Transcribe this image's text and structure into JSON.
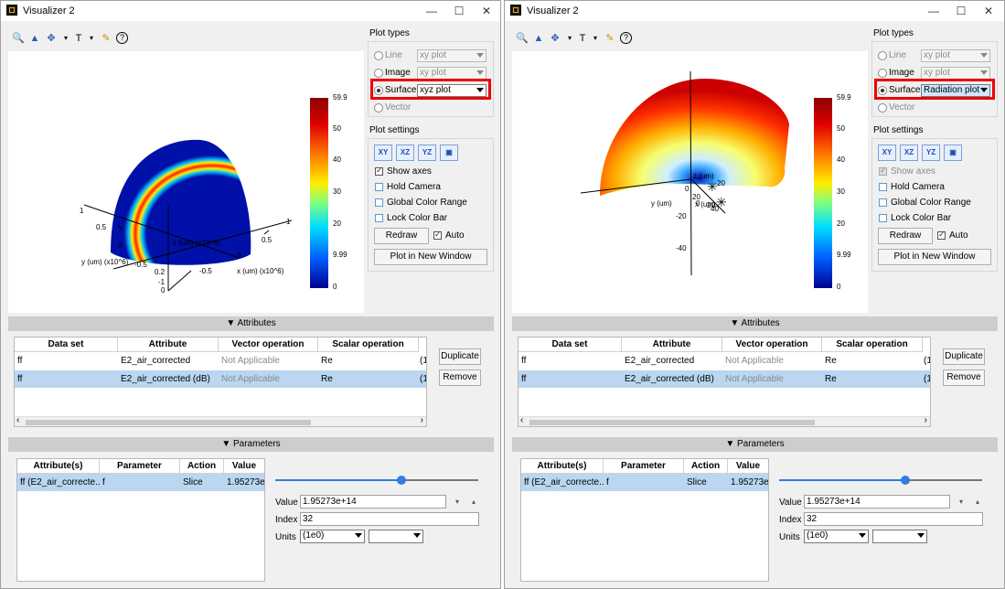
{
  "windows": [
    {
      "title": "Visualizer 2",
      "window_buttons": {
        "minimize": "—",
        "maximize": "☐",
        "close": "✕"
      },
      "colorbar_labels": [
        "59.9",
        "50",
        "40",
        "30",
        "20",
        "9.99",
        "0"
      ],
      "axis_labels": {
        "x": "x (um) (x10^6)",
        "y": "y (um) (x10^6)",
        "z": "z (um) (x10^6)",
        "ticks": [
          "1",
          "0.5",
          "0",
          "-0.5",
          "-1",
          "0.5",
          "0",
          "-0.5",
          "1",
          "0.2",
          "0"
        ]
      },
      "plot_types": {
        "heading": "Plot types",
        "line": {
          "label": "Line",
          "combo": "xy plot",
          "enabled": false
        },
        "image": {
          "label": "Image",
          "combo": "xy plot",
          "enabled": false
        },
        "surface": {
          "label": "Surface",
          "combo": "xyz plot",
          "selected": true
        },
        "vector": {
          "label": "Vector",
          "enabled": false
        }
      },
      "plot_settings": {
        "heading": "Plot settings",
        "buttons": [
          "XY",
          "XZ",
          "YZ"
        ],
        "show_axes": {
          "label": "Show axes",
          "checked": true,
          "enabled": true
        },
        "hold_camera": "Hold Camera",
        "global_color_range": "Global Color Range",
        "lock_color_bar": "Lock Color Bar",
        "redraw": "Redraw",
        "auto": {
          "label": "Auto",
          "checked": true
        },
        "plot_new_window": "Plot in New Window"
      },
      "attributes": {
        "heading": "Attributes",
        "columns": [
          "Data set",
          "Attribute",
          "Vector operation",
          "Scalar operation"
        ],
        "rows": [
          {
            "dataset": "ff",
            "attribute": "E2_air_corrected",
            "vector": "Not Applicable",
            "scalar": "Re",
            "extra": "(1",
            "selected": false
          },
          {
            "dataset": "ff",
            "attribute": "E2_air_corrected (dB)",
            "vector": "Not Applicable",
            "scalar": "Re",
            "extra": "(1",
            "selected": true
          }
        ],
        "duplicate": "Duplicate",
        "remove": "Remove"
      },
      "parameters": {
        "heading": "Parameters",
        "columns": [
          "Attribute(s)",
          "Parameter",
          "Action",
          "Value"
        ],
        "rows": [
          {
            "attribute": "ff (E2_air_correcte...",
            "parameter": "f",
            "action": "Slice",
            "value": "1.95273e+"
          }
        ],
        "slider_level": 0.62,
        "value_label": "Value",
        "value": "1.95273e+14",
        "index_label": "Index",
        "index": "32",
        "units_label": "Units",
        "units": "(1e0)",
        "units2": ""
      }
    },
    {
      "title": "Visualizer 2",
      "window_buttons": {
        "minimize": "—",
        "maximize": "☐",
        "close": "✕"
      },
      "colorbar_labels": [
        "59.9",
        "50",
        "40",
        "30",
        "20",
        "9.99",
        "0"
      ],
      "axis_labels": {
        "y": "y (um)",
        "z": "z (um)",
        "x": "x (um)",
        "ticks": [
          "20",
          "0",
          "-20",
          "-40",
          "20",
          "0",
          "20",
          "40"
        ]
      },
      "plot_types": {
        "heading": "Plot types",
        "line": {
          "label": "Line",
          "combo": "xy plot",
          "enabled": false
        },
        "image": {
          "label": "Image",
          "combo": "xy plot",
          "enabled": false
        },
        "surface": {
          "label": "Surface",
          "combo": "Radiation plot",
          "selected": true
        },
        "vector": {
          "label": "Vector",
          "enabled": false
        }
      },
      "plot_settings": {
        "heading": "Plot settings",
        "buttons": [
          "XY",
          "XZ",
          "YZ"
        ],
        "show_axes": {
          "label": "Show axes",
          "checked": true,
          "enabled": false
        },
        "hold_camera": "Hold Camera",
        "global_color_range": "Global Color Range",
        "lock_color_bar": "Lock Color Bar",
        "redraw": "Redraw",
        "auto": {
          "label": "Auto",
          "checked": true
        },
        "plot_new_window": "Plot in New Window"
      },
      "attributes": {
        "heading": "Attributes",
        "columns": [
          "Data set",
          "Attribute",
          "Vector operation",
          "Scalar operation"
        ],
        "rows": [
          {
            "dataset": "ff",
            "attribute": "E2_air_corrected",
            "vector": "Not Applicable",
            "scalar": "Re",
            "extra": "(1",
            "selected": false
          },
          {
            "dataset": "ff",
            "attribute": "E2_air_corrected (dB)",
            "vector": "Not Applicable",
            "scalar": "Re",
            "extra": "(1",
            "selected": true
          }
        ],
        "duplicate": "Duplicate",
        "remove": "Remove"
      },
      "parameters": {
        "heading": "Parameters",
        "columns": [
          "Attribute(s)",
          "Parameter",
          "Action",
          "Value"
        ],
        "rows": [
          {
            "attribute": "ff (E2_air_correcte...",
            "parameter": "f",
            "action": "Slice",
            "value": "1.95273e+"
          }
        ],
        "slider_level": 0.62,
        "value_label": "Value",
        "value": "1.95273e+14",
        "index_label": "Index",
        "index": "32",
        "units_label": "Units",
        "units": "(1e0)",
        "units2": ""
      }
    }
  ]
}
